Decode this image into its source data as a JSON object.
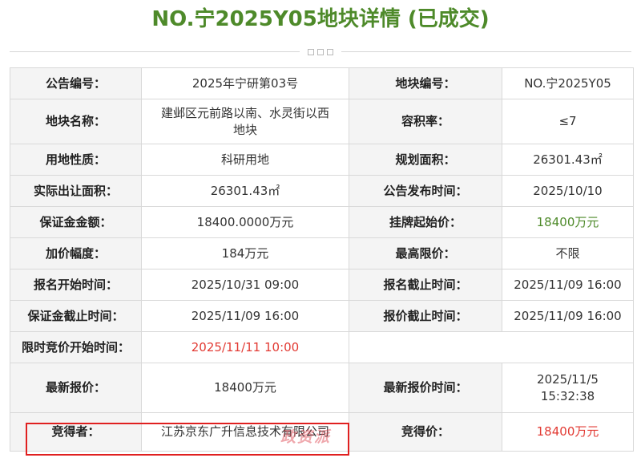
{
  "page": {
    "title": "NO.宁2025Y05地块详情 (已成交)"
  },
  "colors": {
    "title_green": "#4e8a2a",
    "price_green": "#4e8a2a",
    "price_red": "#e23a33",
    "highlight_red": "#e02020"
  },
  "table": {
    "notice_no_label": "公告编号：",
    "notice_no": "2025年宁研第03号",
    "parcel_no_label": "地块编号：",
    "parcel_no": "NO.宁2025Y05",
    "parcel_name_label": "地块名称：",
    "parcel_name_line1": "建邺区元前路以南、水灵街以西",
    "parcel_name_line2": "地块",
    "plot_ratio_label": "容积率：",
    "plot_ratio": "≤7",
    "land_use_label": "用地性质：",
    "land_use": "科研用地",
    "planned_area_label": "规划面积：",
    "planned_area": "26301.43㎡",
    "actual_area_label": "实际出让面积：",
    "actual_area": "26301.43㎡",
    "publish_time_label": "公告发布时间：",
    "publish_time": "2025/10/10",
    "deposit_label": "保证金金额：",
    "deposit": "18400.0000万元",
    "start_price_label": "挂牌起始价：",
    "start_price": "18400万元",
    "increment_label": "加价幅度：",
    "increment": "184万元",
    "max_price_label": "最高限价：",
    "max_price": "不限",
    "reg_start_label": "报名开始时间：",
    "reg_start": "2025/10/31 09:00",
    "reg_end_label": "报名截止时间：",
    "reg_end": "2025/11/09 16:00",
    "deposit_end_label": "保证金截止时间：",
    "deposit_end": "2025/11/09 16:00",
    "bid_end_label": "报价截止时间：",
    "bid_end": "2025/11/09 16:00",
    "timed_bid_start_label": "限时竞价开始时间：",
    "timed_bid_start": "2025/11/11 10:00",
    "latest_bid_label": "最新报价：",
    "latest_bid": "18400万元",
    "latest_bid_time_label": "最新报价时间：",
    "latest_bid_date": "2025/11/5",
    "latest_bid_clock": "15:32:38",
    "winner_label": "竞得者：",
    "winner": "江苏京东广升信息技术有限公司",
    "winning_price_label": "竞得价：",
    "winning_price": "18400万元"
  },
  "watermark": "政资派"
}
